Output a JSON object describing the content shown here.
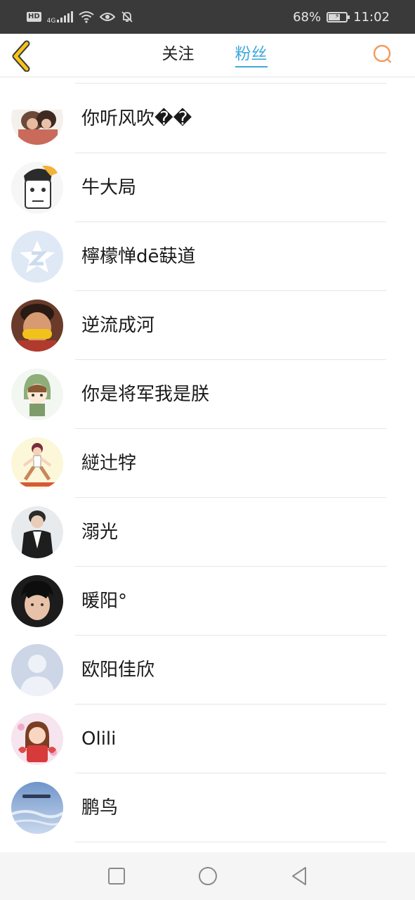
{
  "status_bar": {
    "hd_badge": "HD",
    "network": "4G",
    "battery_percent": "68%",
    "battery_level": 0.68,
    "time": "11:02"
  },
  "header": {
    "back_icon": "chevron-left-icon",
    "tabs": [
      {
        "label": "关注",
        "active": false
      },
      {
        "label": "粉丝",
        "active": true
      }
    ],
    "search_icon": "search-icon",
    "accent_color": "#3fa9dc",
    "back_color": "#f5c518",
    "search_color": "#f29a5c"
  },
  "fans": [
    {
      "name": "你听风吹��",
      "avatar": "photo-avatar"
    },
    {
      "name": "牛大局",
      "avatar": "cartoon-avatar"
    },
    {
      "name": "檸檬惮dē蒛道",
      "avatar": "default-qzone-avatar"
    },
    {
      "name": "逆流成河",
      "avatar": "photo-avatar"
    },
    {
      "name": "你是将军我是朕",
      "avatar": "cartoon-avatar"
    },
    {
      "name": "縌辻牸",
      "avatar": "cartoon-avatar"
    },
    {
      "name": "溺光",
      "avatar": "photo-avatar"
    },
    {
      "name": "暖阳°",
      "avatar": "photo-avatar"
    },
    {
      "name": "欧阳佳欣",
      "avatar": "default-person-avatar"
    },
    {
      "name": "Olili",
      "avatar": "cartoon-avatar"
    },
    {
      "name": "鹏鸟",
      "avatar": "sky-photo-avatar"
    }
  ],
  "nav_bar": {
    "icons": [
      "recent-apps-icon",
      "home-icon",
      "back-icon"
    ]
  }
}
